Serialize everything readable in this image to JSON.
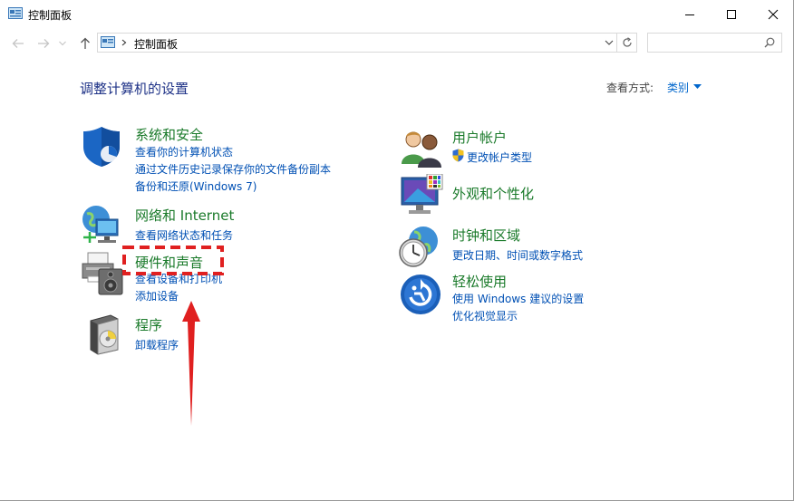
{
  "window": {
    "title": "控制面板"
  },
  "address": {
    "crumb": "控制面板",
    "search_placeholder": ""
  },
  "heading": "调整计算机的设置",
  "view_by": {
    "label": "查看方式:",
    "value": "类别"
  },
  "categories": [
    {
      "title": "系统和安全",
      "links": [
        "查看你的计算机状态",
        "通过文件历史记录保存你的文件备份副本",
        "备份和还原(Windows 7)"
      ]
    },
    {
      "title": "网络和 Internet",
      "links": [
        "查看网络状态和任务"
      ]
    },
    {
      "title": "硬件和声音",
      "links": [
        "查看设备和打印机",
        "添加设备"
      ]
    },
    {
      "title": "程序",
      "links": [
        "卸载程序"
      ]
    },
    {
      "title": "用户帐户",
      "links": [
        "更改帐户类型"
      ]
    },
    {
      "title": "外观和个性化",
      "links": []
    },
    {
      "title": "时钟和区域",
      "links": [
        "更改日期、时间或数字格式"
      ]
    },
    {
      "title": "轻松使用",
      "links": [
        "使用 Windows 建议的设置",
        "优化视觉显示"
      ]
    }
  ],
  "colors": {
    "heading": "#1e3287",
    "category_title": "#1a7a2a",
    "link": "#0050b4",
    "highlight": "#e02020"
  }
}
